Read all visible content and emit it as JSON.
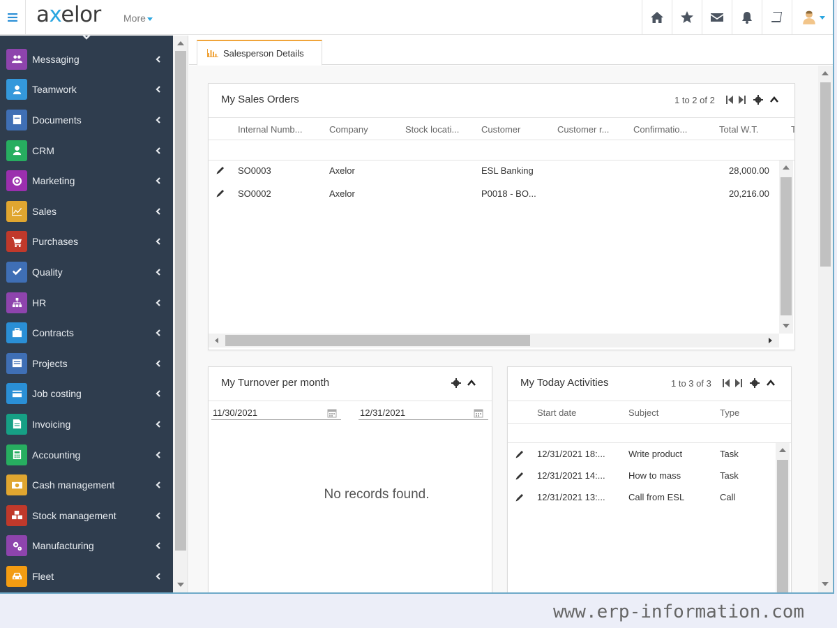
{
  "app": {
    "logo_pre": "a",
    "logo_x": "x",
    "logo_post": "elor",
    "more_label": "More"
  },
  "sidebar": {
    "items": [
      {
        "label": "Messaging",
        "icon": "users-icon",
        "color": "#8e44ad"
      },
      {
        "label": "Teamwork",
        "icon": "user-icon",
        "color": "#3498db"
      },
      {
        "label": "Documents",
        "icon": "document-icon",
        "color": "#3f6fb5"
      },
      {
        "label": "CRM",
        "icon": "contact-icon",
        "color": "#27ae60"
      },
      {
        "label": "Marketing",
        "icon": "target-icon",
        "color": "#9b2fae"
      },
      {
        "label": "Sales",
        "icon": "chart-icon",
        "color": "#e0a630"
      },
      {
        "label": "Purchases",
        "icon": "cart-icon",
        "color": "#c0392b"
      },
      {
        "label": "Quality",
        "icon": "check-icon",
        "color": "#3f6fb5"
      },
      {
        "label": "HR",
        "icon": "org-icon",
        "color": "#8e44ad"
      },
      {
        "label": "Contracts",
        "icon": "briefcase-icon",
        "color": "#2a8fd6"
      },
      {
        "label": "Projects",
        "icon": "list-icon",
        "color": "#3f6fb5"
      },
      {
        "label": "Job costing",
        "icon": "card-icon",
        "color": "#2a8fd6"
      },
      {
        "label": "Invoicing",
        "icon": "invoice-icon",
        "color": "#16a085"
      },
      {
        "label": "Accounting",
        "icon": "calculator-icon",
        "color": "#27ae60"
      },
      {
        "label": "Cash management",
        "icon": "money-icon",
        "color": "#e0a630"
      },
      {
        "label": "Stock management",
        "icon": "cubes-icon",
        "color": "#c0392b"
      },
      {
        "label": "Manufacturing",
        "icon": "cogs-icon",
        "color": "#8e44ad"
      },
      {
        "label": "Fleet",
        "icon": "car-icon",
        "color": "#f39c12"
      }
    ]
  },
  "tab": {
    "label": "Salesperson Details"
  },
  "sales_orders": {
    "title": "My Sales Orders",
    "pager": "1 to 2 of 2",
    "columns": [
      "Internal Numb...",
      "Company",
      "Stock locati...",
      "Customer",
      "Customer r...",
      "Confirmatio...",
      "Total W.T.",
      "T"
    ],
    "rows": [
      {
        "number": "SO0003",
        "company": "Axelor",
        "customer": "ESL Banking",
        "total": "28,000.00"
      },
      {
        "number": "SO0002",
        "company": "Axelor",
        "customer": "P0018 - BO...",
        "total": "20,216.00"
      }
    ]
  },
  "turnover": {
    "title": "My Turnover per month",
    "date_from": "11/30/2021",
    "date_to": "12/31/2021",
    "empty_text": "No records found."
  },
  "activities": {
    "title": "My Today Activities",
    "pager": "1 to 3 of 3",
    "columns": [
      "Start date",
      "Subject",
      "Type"
    ],
    "rows": [
      {
        "start": "12/31/2021 18:...",
        "subject": "Write product",
        "type": "Task"
      },
      {
        "start": "12/31/2021 14:...",
        "subject": "How to mass",
        "type": "Task"
      },
      {
        "start": "12/31/2021 13:...",
        "subject": "Call from ESL",
        "type": "Call"
      }
    ]
  },
  "watermark": "www.erp-information.com"
}
